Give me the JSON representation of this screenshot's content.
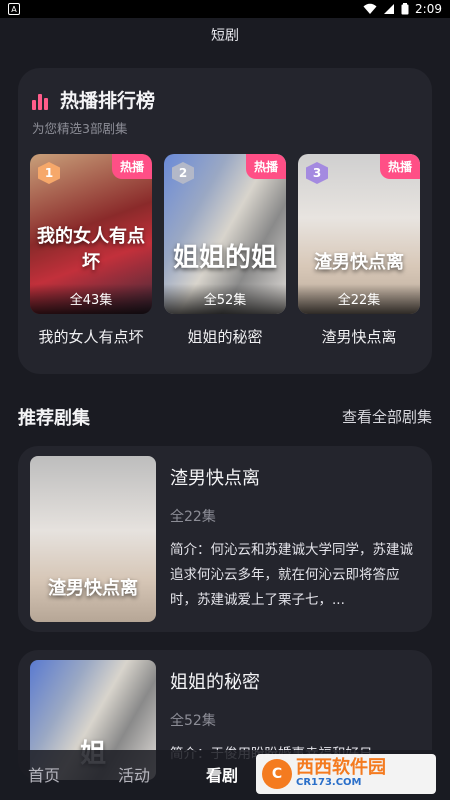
{
  "status": {
    "time": "2:09"
  },
  "app": {
    "title": "短剧"
  },
  "hot": {
    "title": "热播排行榜",
    "subtitle": "为您精选3部剧集",
    "tag": "热播",
    "items": [
      {
        "rank": "1",
        "poster_text": "我的女人有点坏",
        "episodes": "全43集",
        "name": "我的女人有点坏",
        "rank_color": "#f6a86a"
      },
      {
        "rank": "2",
        "poster_text": "姐姐的姐",
        "episodes": "全52集",
        "name": "姐姐的秘密",
        "rank_color": "#b3b8c8"
      },
      {
        "rank": "3",
        "poster_text": "渣男快点离",
        "episodes": "全22集",
        "name": "渣男快点离",
        "rank_color": "#a48ae0"
      }
    ]
  },
  "recommend": {
    "title": "推荐剧集",
    "view_all": "查看全部剧集",
    "items": [
      {
        "name": "渣男快点离",
        "episodes": "全22集",
        "poster_text": "渣男快点离",
        "desc": "简介：何沁云和苏建诚大学同学，苏建诚追求何沁云多年，就在何沁云即将答应时，苏建诚爱上了栗子七，..."
      },
      {
        "name": "姐姐的秘密",
        "episodes": "全52集",
        "poster_text": "姐",
        "desc": "简介：于俊用盼盼婚事幸福和好日"
      }
    ]
  },
  "nav": {
    "home": "首页",
    "activity": "活动",
    "watch": "看剧"
  },
  "watermark": {
    "brand": "西西软件园",
    "url": "CR173.COM"
  }
}
